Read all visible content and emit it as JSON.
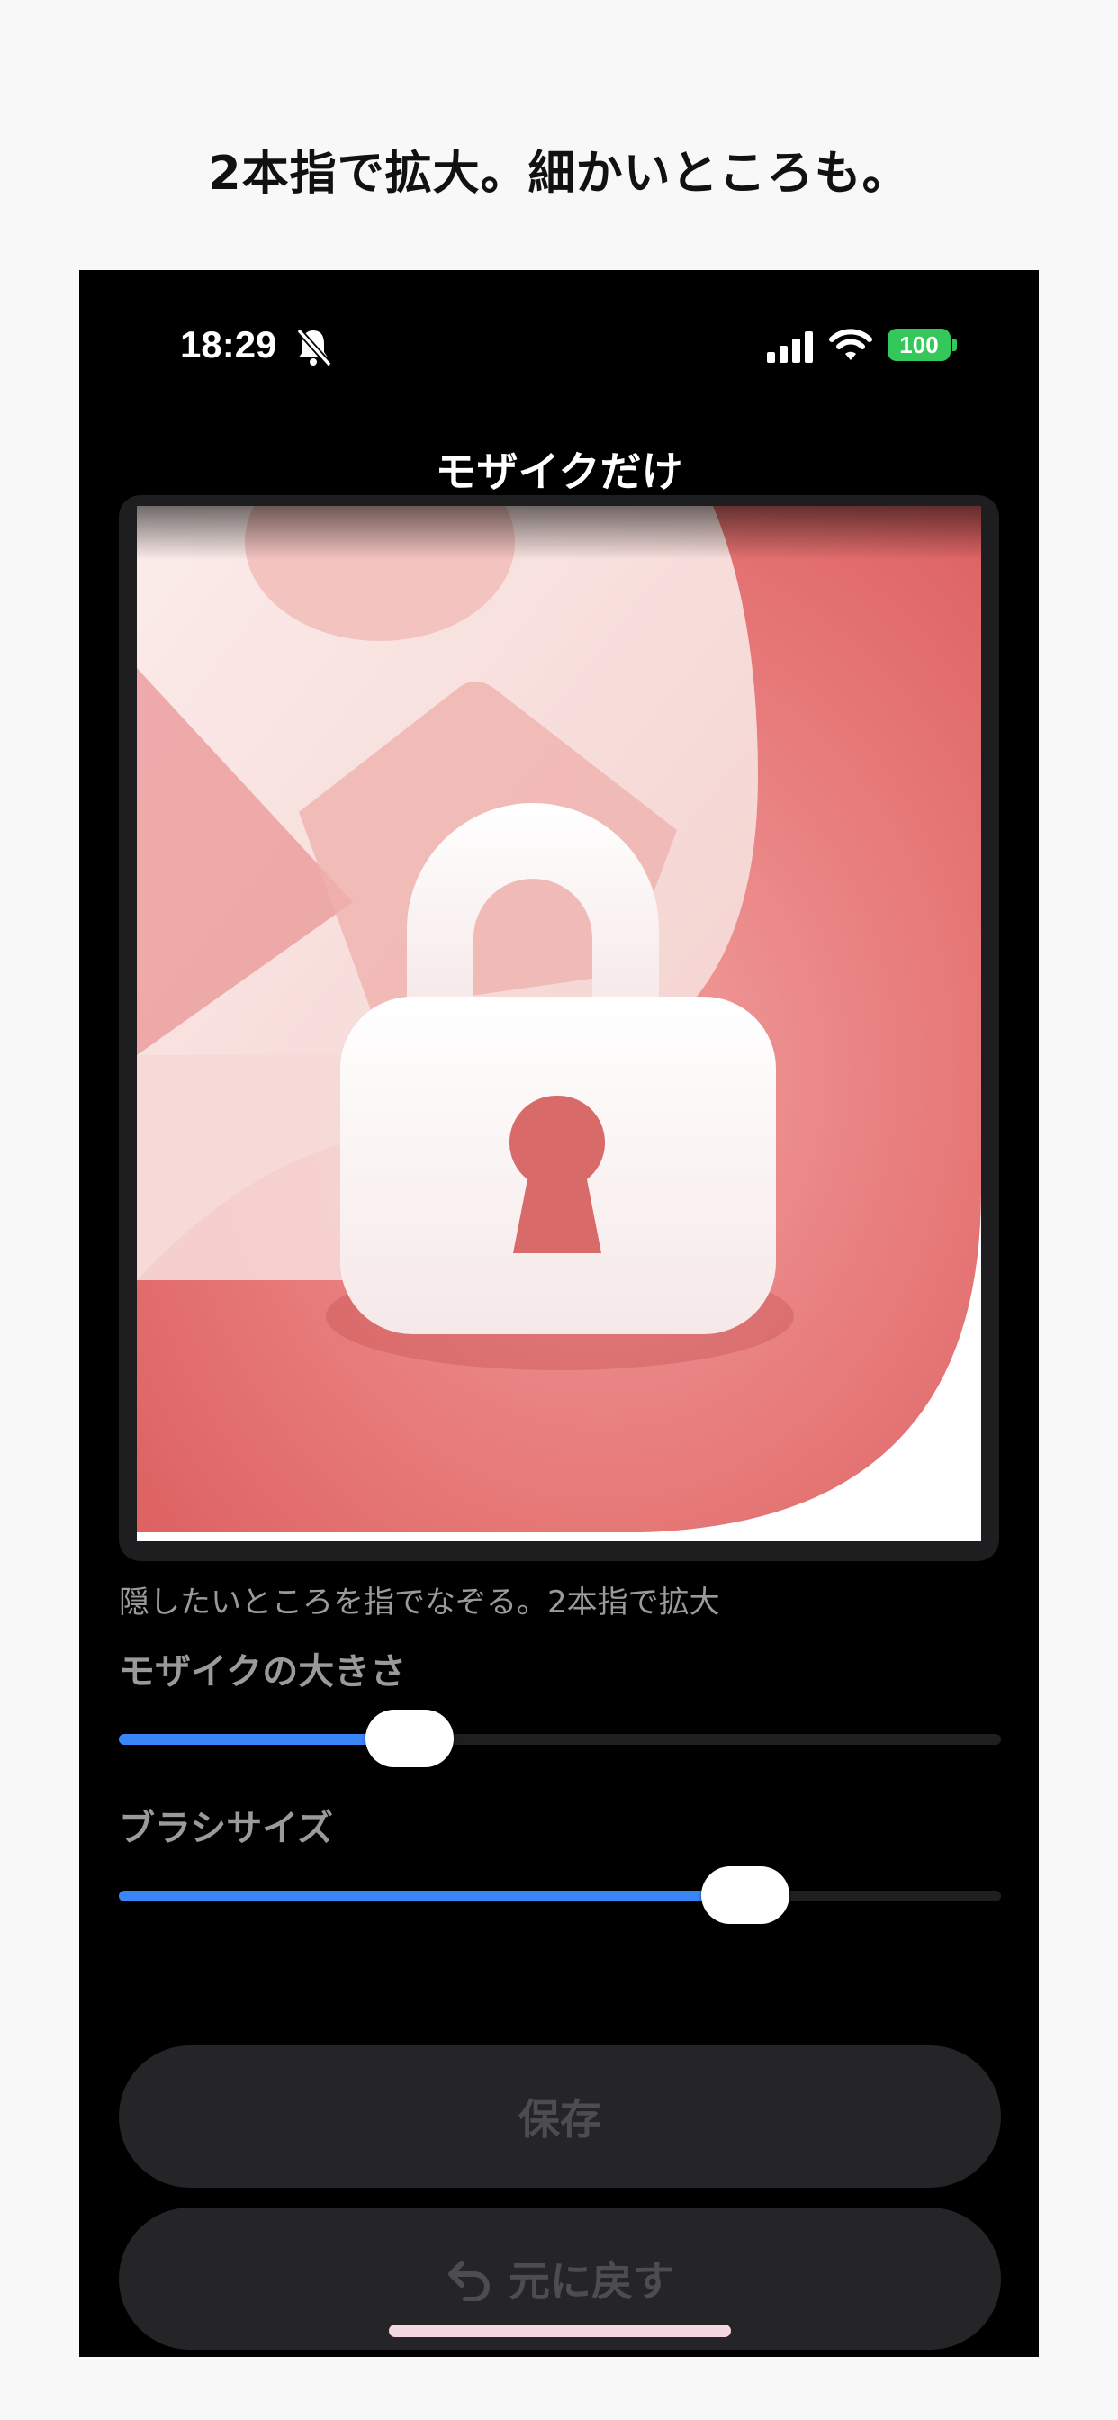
{
  "headline": "2本指で拡大。細かいところも。",
  "status_bar": {
    "time": "18:29",
    "battery": "100",
    "bell_icon": "bell-slash-icon",
    "signal_icon": "cellular-signal-icon",
    "wifi_icon": "wifi-icon"
  },
  "screen": {
    "title": "モザイクだけ",
    "hint": "隠したいところを指でなぞる。2本指で拡大"
  },
  "mosaic_size": {
    "label": "モザイクの大きさ",
    "value": 0.33
  },
  "brush_size": {
    "label": "ブラシサイズ",
    "value": 0.71
  },
  "buttons": {
    "save": "保存",
    "undo": "元に戻す",
    "undo_icon": "undo-arrow-icon"
  },
  "colors": {
    "accent": "#3b86f7",
    "battery": "#34c759",
    "image_red": "#e46a6a"
  }
}
